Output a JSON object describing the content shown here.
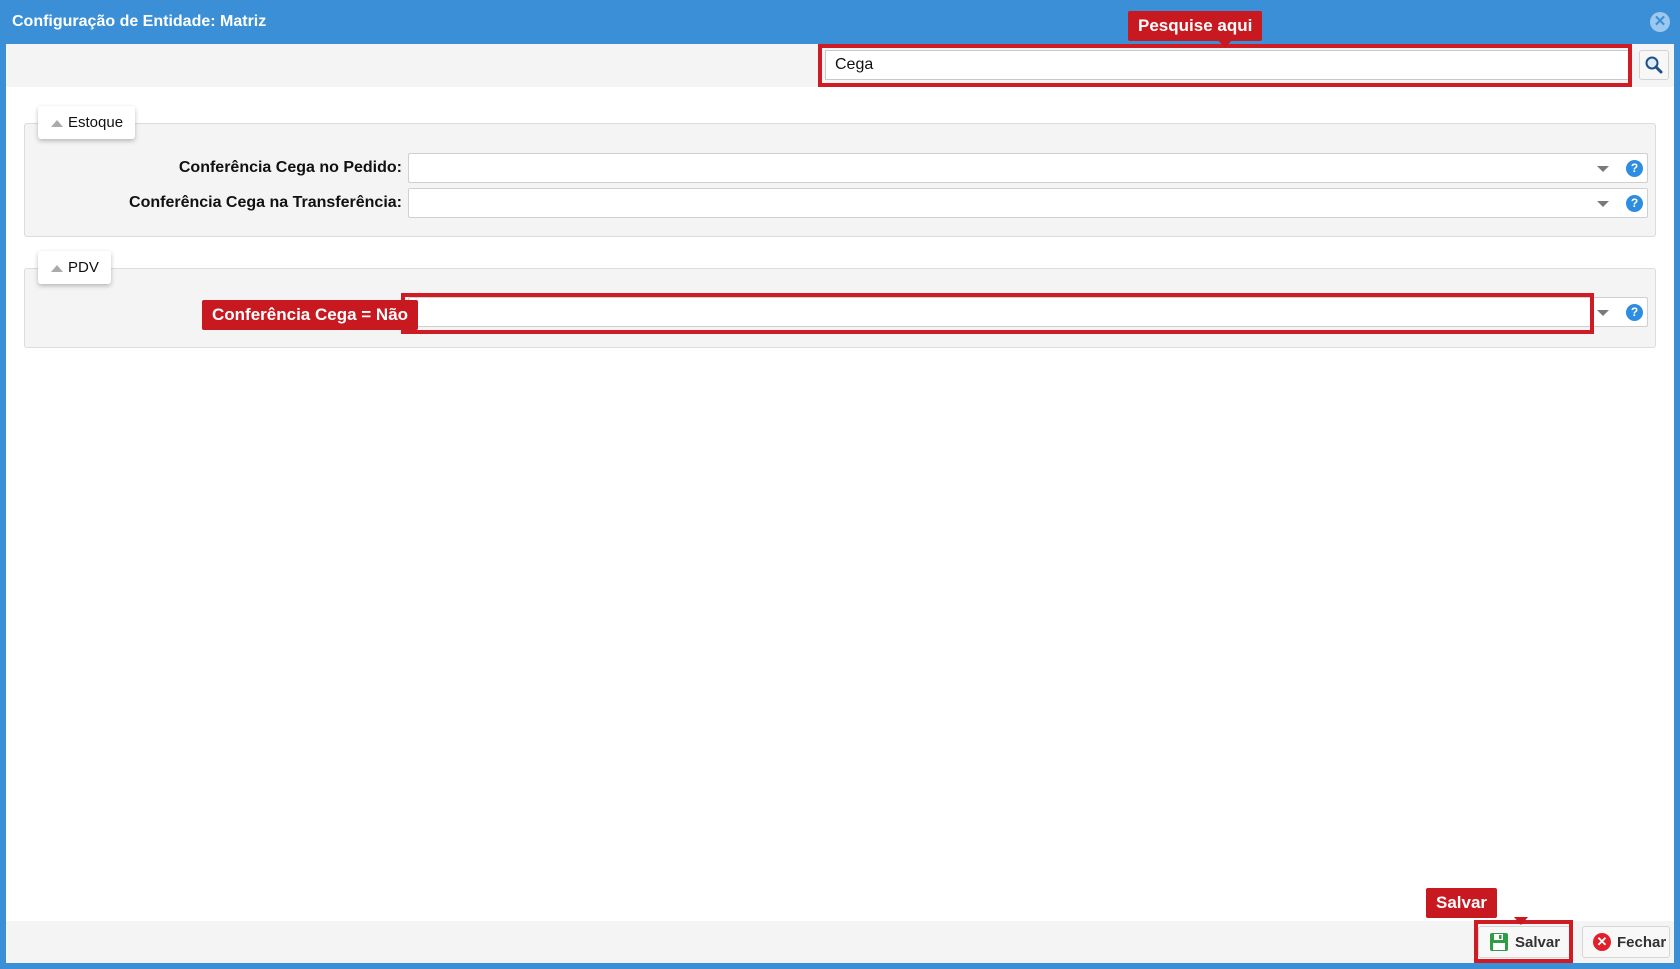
{
  "window": {
    "title": "Configuração de Entidade: Matriz",
    "close_icon": "close-circle-icon"
  },
  "search": {
    "value": "Cega",
    "icon": "search-icon"
  },
  "annotations": {
    "search_label": "Pesquise aqui",
    "pdv_label": "Conferência Cega = Não",
    "save_label": "Salvar",
    "color": "#c81820"
  },
  "sections": {
    "estoque": {
      "title": "Estoque",
      "fields": [
        {
          "label": "Conferência Cega no Pedido:",
          "value": ""
        },
        {
          "label": "Conferência Cega na Transferência:",
          "value": ""
        }
      ]
    },
    "pdv": {
      "title": "PDV",
      "fields": [
        {
          "label": "",
          "value": ""
        }
      ]
    }
  },
  "footer": {
    "save_label": "Salvar",
    "close_label": "Fechar"
  },
  "colors": {
    "titlebar": "#3a8fd6",
    "help": "#2e8de0",
    "save_icon": "#2e9e45",
    "close_icon": "#e0202a"
  }
}
